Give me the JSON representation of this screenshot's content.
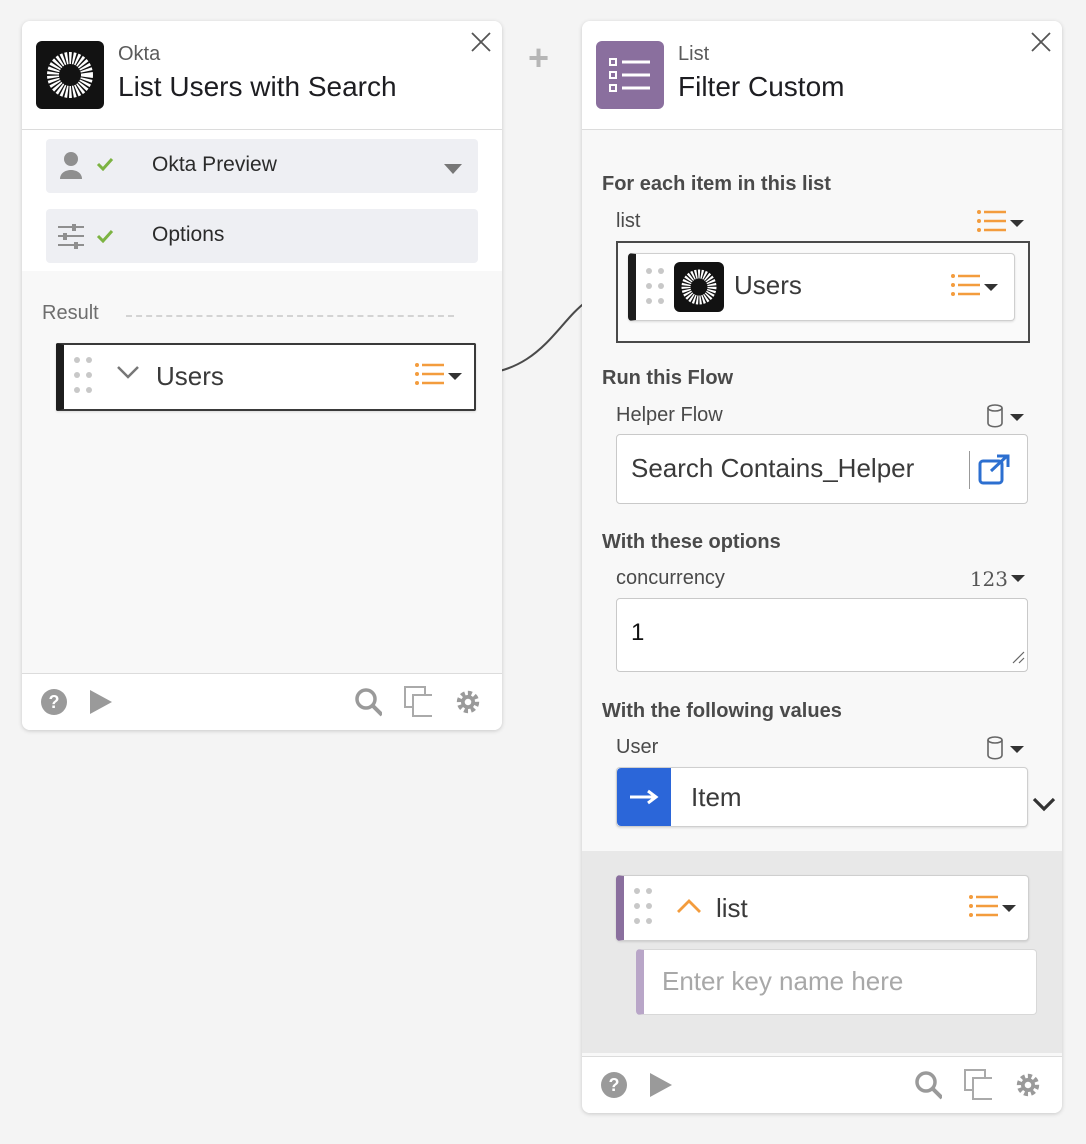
{
  "add_card_symbol": "+",
  "card1": {
    "app": "Okta",
    "title": "List Users with Search",
    "connection": {
      "label": "Okta Preview",
      "status": "check"
    },
    "options": {
      "label": "Options",
      "status": "check"
    },
    "result_label": "Result",
    "output_field": {
      "label": "Users",
      "type_icon": "list-icon"
    },
    "footer_icons": [
      "help-icon",
      "play-icon",
      "search-icon",
      "copy-icon",
      "gear-icon"
    ]
  },
  "card2": {
    "app": "List",
    "title": "Filter Custom",
    "sec_items": "For each item in this list",
    "list_label": "list",
    "list_chip": "Users",
    "sec_flow": "Run this Flow",
    "helper_label": "Helper Flow",
    "helper_value": "Search Contains_Helper",
    "sec_options": "With these options",
    "concurrency_label": "concurrency",
    "concurrency_type": "123",
    "concurrency_value": "1",
    "sec_values": "With the following values",
    "user_label": "User",
    "user_value": "Item",
    "list_field": "list",
    "key_placeholder": "Enter key name here",
    "footer_icons": [
      "help-icon",
      "play-icon",
      "search-icon",
      "copy-icon",
      "gear-icon"
    ]
  },
  "colors": {
    "accent_orange": "#f39c3d",
    "check_green": "#7cb342",
    "list_purple": "#8a6f9e",
    "item_blue": "#2b66d9",
    "link_blue": "#2c6fd0"
  }
}
